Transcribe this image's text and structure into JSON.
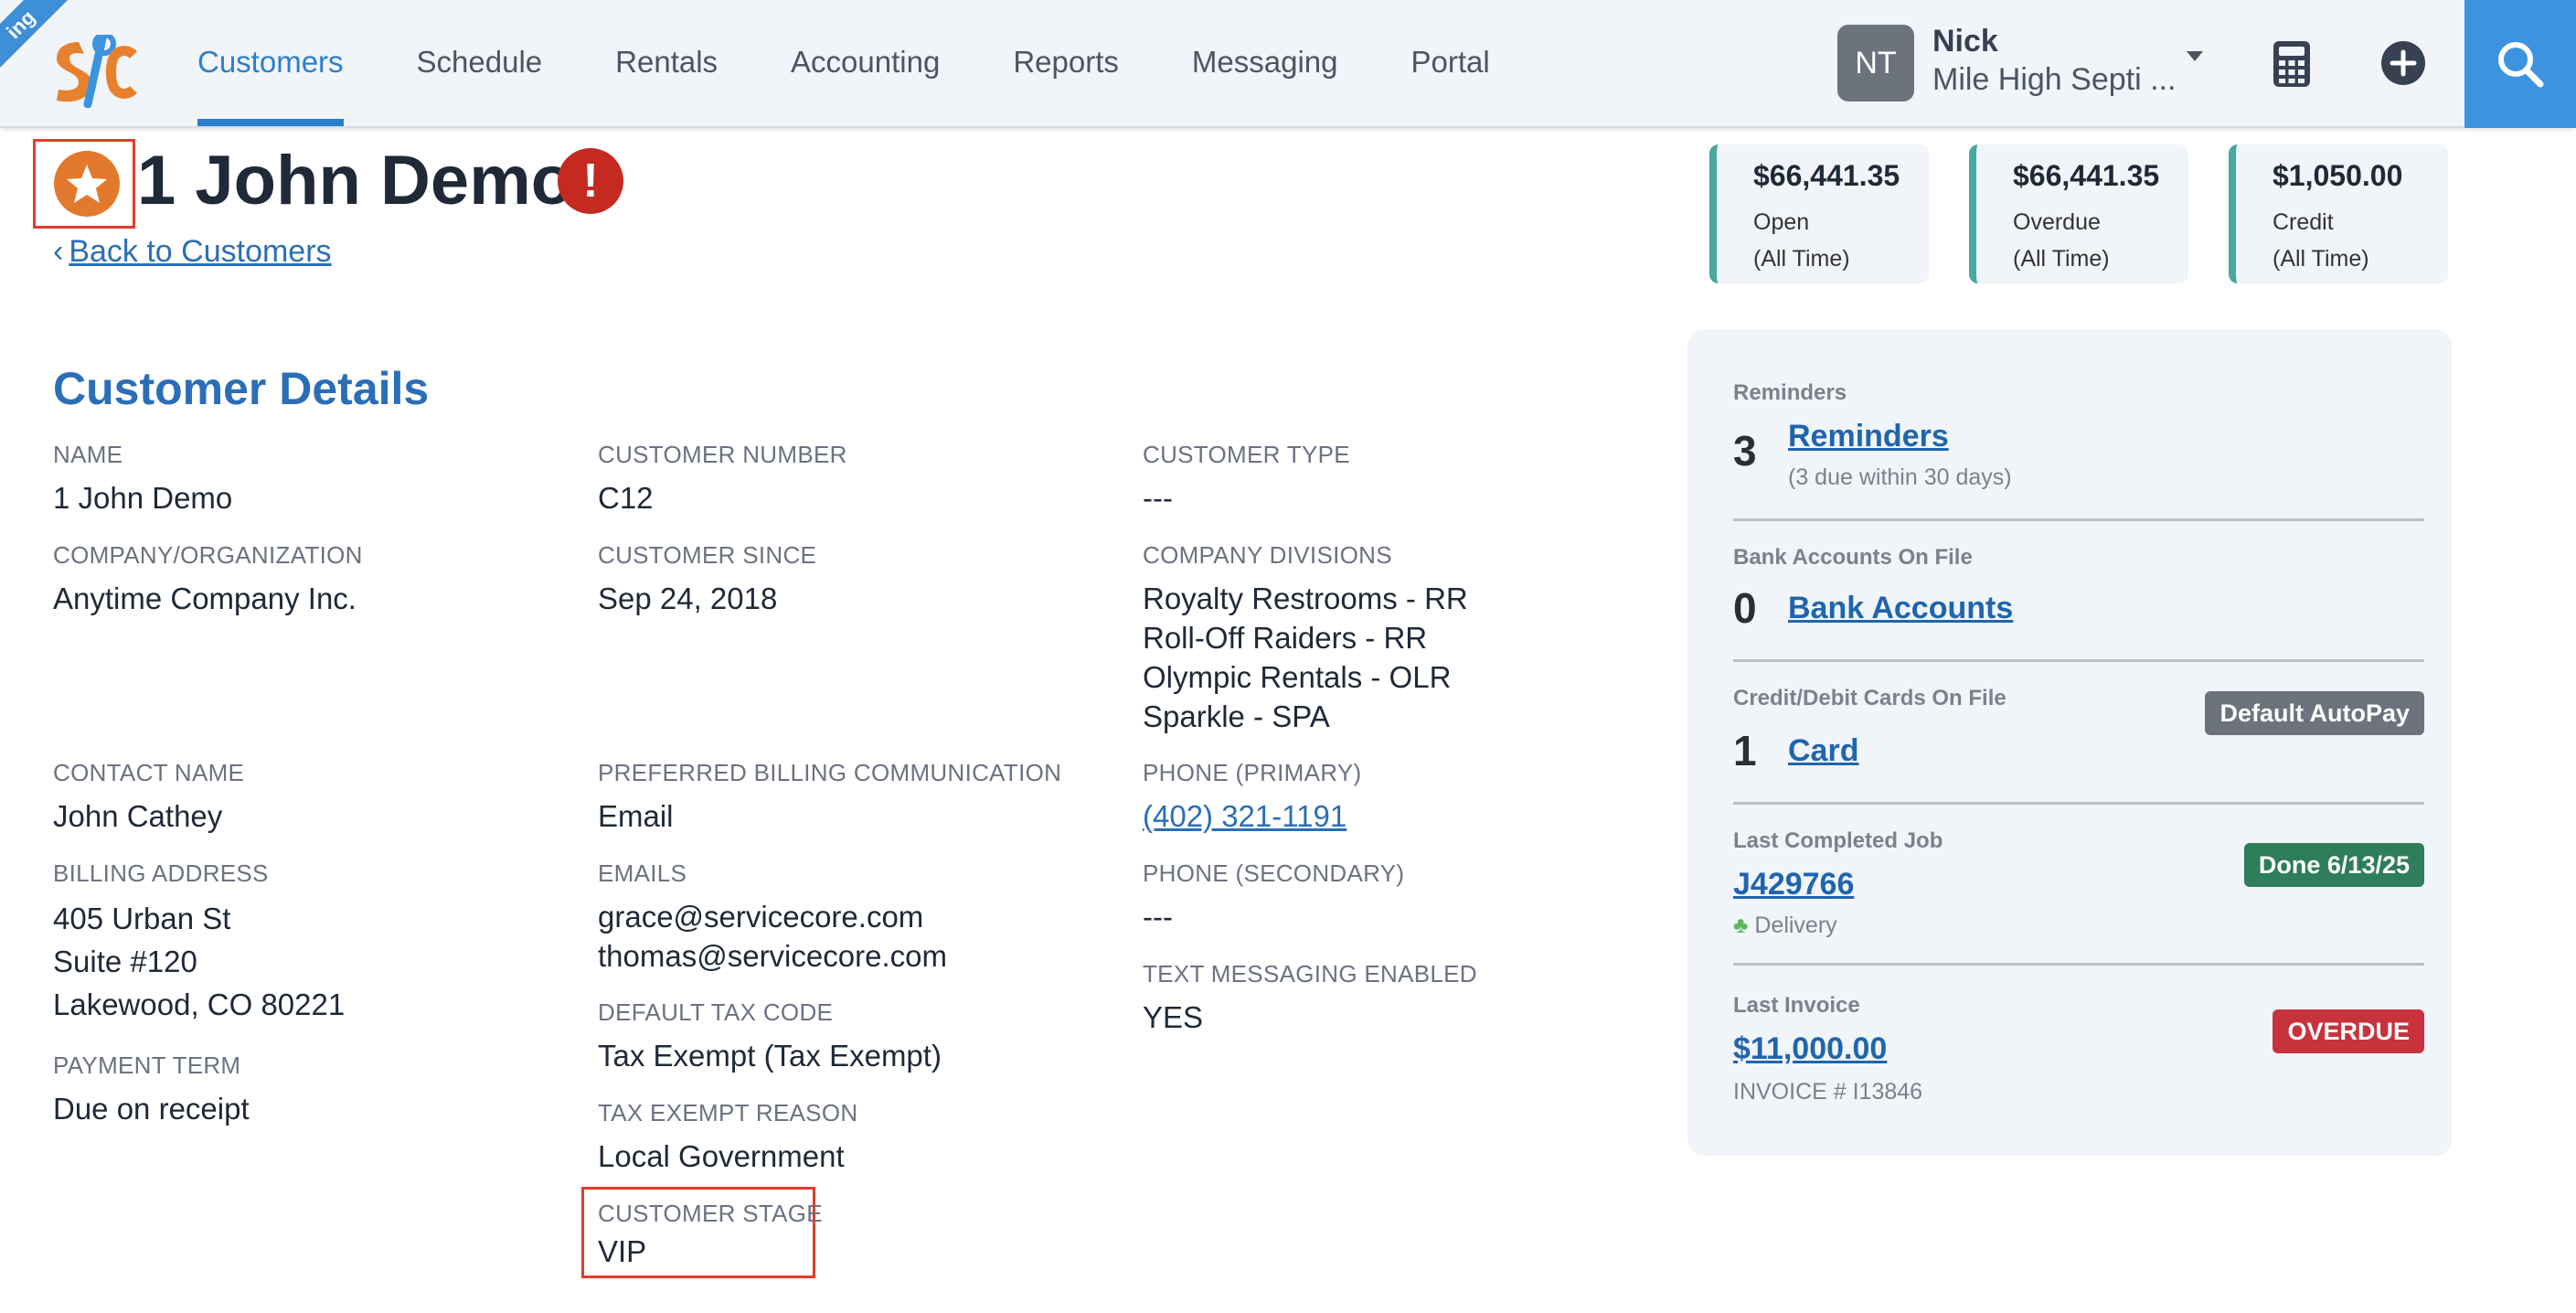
{
  "app": {
    "ribbon": "ing",
    "brand_colors": {
      "accent": "#2a7fcd",
      "logo_orange": "#e8812e",
      "logo_blue": "#3d93e0"
    }
  },
  "nav": {
    "items": [
      {
        "label": "Customers",
        "active": true
      },
      {
        "label": "Schedule"
      },
      {
        "label": "Rentals"
      },
      {
        "label": "Accounting"
      },
      {
        "label": "Reports"
      },
      {
        "label": "Messaging"
      },
      {
        "label": "Portal"
      }
    ]
  },
  "user": {
    "initials": "NT",
    "name": "Nick",
    "company": "Mile High Septi ..."
  },
  "header": {
    "title": "1 John Demo",
    "alert_symbol": "!",
    "back_link": "Back to Customers"
  },
  "summary": [
    {
      "amount": "$66,441.35",
      "label": "Open",
      "period": "(All Time)"
    },
    {
      "amount": "$66,441.35",
      "label": "Overdue",
      "period": "(All Time)"
    },
    {
      "amount": "$1,050.00",
      "label": "Credit",
      "period": "(All Time)"
    }
  ],
  "details": {
    "section_title": "Customer Details",
    "name": {
      "label": "NAME",
      "value": "1 John Demo"
    },
    "customer_number": {
      "label": "CUSTOMER NUMBER",
      "value": "C12"
    },
    "customer_type": {
      "label": "CUSTOMER TYPE",
      "value": "---"
    },
    "company": {
      "label": "COMPANY/ORGANIZATION",
      "value": "Anytime Company Inc."
    },
    "customer_since": {
      "label": "CUSTOMER SINCE",
      "value": "Sep 24, 2018"
    },
    "divisions": {
      "label": "COMPANY DIVISIONS",
      "values": [
        "Royalty Restrooms - RR",
        "Roll-Off Raiders - RR",
        "Olympic Rentals - OLR",
        "Sparkle - SPA"
      ]
    },
    "contact_name": {
      "label": "CONTACT NAME",
      "value": "John Cathey"
    },
    "billing_comm": {
      "label": "PREFERRED BILLING COMMUNICATION",
      "value": "Email"
    },
    "phone_primary": {
      "label": "PHONE (PRIMARY)",
      "value": "(402) 321-1191"
    },
    "billing_address": {
      "label": "BILLING ADDRESS",
      "lines": [
        "405 Urban St",
        "Suite #120",
        "Lakewood, CO 80221"
      ]
    },
    "emails": {
      "label": "EMAILS",
      "values": [
        "grace@servicecore.com",
        "thomas@servicecore.com"
      ]
    },
    "phone_secondary": {
      "label": "PHONE (SECONDARY)",
      "value": "---"
    },
    "text_messaging": {
      "label": "TEXT MESSAGING ENABLED",
      "value": "YES"
    },
    "default_tax": {
      "label": "DEFAULT TAX CODE",
      "value": "Tax Exempt (Tax Exempt)"
    },
    "payment_term": {
      "label": "PAYMENT TERM",
      "value": "Due on receipt"
    },
    "tax_exempt_reason": {
      "label": "TAX EXEMPT REASON",
      "value": "Local Government"
    },
    "customer_stage": {
      "label": "CUSTOMER STAGE",
      "value": "VIP"
    }
  },
  "panel": {
    "reminders": {
      "label": "Reminders",
      "count": "3",
      "link": "Reminders",
      "sub": "(3 due within 30 days)"
    },
    "bank": {
      "label": "Bank Accounts On File",
      "count": "0",
      "link": "Bank Accounts"
    },
    "cards": {
      "label": "Credit/Debit Cards On File",
      "count": "1",
      "link": "Card",
      "badge": "Default AutoPay",
      "badge_color": "#6c737c"
    },
    "last_job": {
      "label": "Last Completed Job",
      "link": "J429766",
      "sub": "Delivery",
      "badge": "Done 6/13/25",
      "badge_color": "#2e7d5b"
    },
    "last_invoice": {
      "label": "Last Invoice",
      "link": "$11,000.00",
      "sub": "INVOICE # I13846",
      "badge": "OVERDUE",
      "badge_color": "#c8323d"
    }
  }
}
